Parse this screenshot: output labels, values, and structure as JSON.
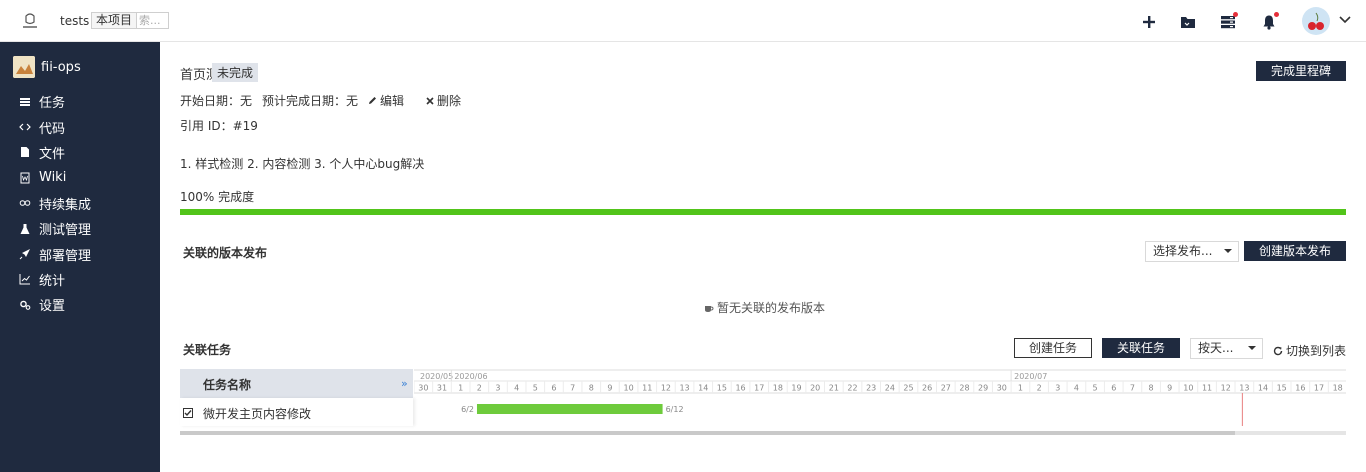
{
  "header": {
    "project": "tests",
    "scope_label": "本项目",
    "search_placeholder": "索...",
    "icons": [
      "plus-icon",
      "folder-icon",
      "server-icon",
      "bell-icon",
      "avatar",
      "chevron-down-icon"
    ]
  },
  "sidebar": {
    "org": "fii-ops",
    "items": [
      {
        "label": "任务",
        "icon": "list-icon"
      },
      {
        "label": "代码",
        "icon": "code-icon"
      },
      {
        "label": "文件",
        "icon": "file-icon"
      },
      {
        "label": "Wiki",
        "icon": "wiki-icon"
      },
      {
        "label": "持续集成",
        "icon": "infinity-icon"
      },
      {
        "label": "测试管理",
        "icon": "flask-icon"
      },
      {
        "label": "部署管理",
        "icon": "rocket-icon"
      },
      {
        "label": "统计",
        "icon": "chart-icon"
      },
      {
        "label": "设置",
        "icon": "gear-icon"
      }
    ]
  },
  "milestone": {
    "title": "首页测试",
    "status": "未完成",
    "complete_btn": "完成里程碑",
    "start_label": "开始日期：无",
    "due_label": "预计完成日期：无",
    "edit": "编辑",
    "delete": "删除",
    "ref": "引用 ID：#19",
    "description": "1. 样式检测 2. 内容检测 3. 个人中心bug解决",
    "progress_text": "100% 完成度",
    "progress": 1.0
  },
  "releases": {
    "title": "关联的版本发布",
    "select": "选择发布...",
    "create_btn": "创建版本发布",
    "empty": "暂无关联的发布版本"
  },
  "tasks": {
    "title": "关联任务",
    "create_btn": "创建任务",
    "link_btn": "关联任务",
    "scale_select": "按天...",
    "switch": "切换到列表",
    "column": "任务名称",
    "expand": "»",
    "rows": [
      {
        "name": "微开发主页内容修改",
        "start": "6/2",
        "end": "6/12"
      }
    ]
  },
  "gantt": {
    "months": [
      "2020/05",
      "2020/06",
      "2020/07"
    ],
    "days": [
      "30",
      "31",
      "1",
      "2",
      "3",
      "4",
      "5",
      "6",
      "7",
      "8",
      "9",
      "10",
      "11",
      "12",
      "13",
      "14",
      "15",
      "16",
      "17",
      "18",
      "19",
      "20",
      "21",
      "22",
      "23",
      "24",
      "25",
      "26",
      "27",
      "28",
      "29",
      "30",
      "1",
      "2",
      "3",
      "4",
      "5",
      "6",
      "7",
      "8",
      "9",
      "10",
      "11",
      "12",
      "13",
      "14",
      "15",
      "16",
      "17",
      "18"
    ],
    "bar_start_index": 3,
    "bar_end_index": 13,
    "today_index": 44,
    "bar_color": "#6ecb3c",
    "today_color": "#e88080"
  }
}
